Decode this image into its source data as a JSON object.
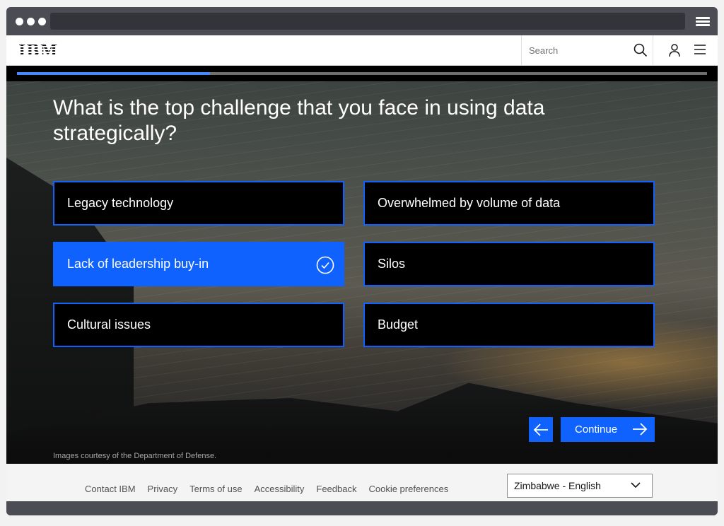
{
  "masthead": {
    "logo": "IBM",
    "search_placeholder": "Search"
  },
  "quiz": {
    "progress": 0.28,
    "question": "What is the top challenge that you face in using data strategically?",
    "options": [
      {
        "label": "Legacy technology",
        "selected": false
      },
      {
        "label": "Overwhelmed by volume of data",
        "selected": false
      },
      {
        "label": "Lack of leadership buy-in",
        "selected": true
      },
      {
        "label": "Silos",
        "selected": false
      },
      {
        "label": "Cultural issues",
        "selected": false
      },
      {
        "label": "Budget",
        "selected": false
      }
    ],
    "continue_label": "Continue",
    "credit": "Images courtesy of the Department of Defense."
  },
  "footer": {
    "links": [
      "Contact IBM",
      "Privacy",
      "Terms of use",
      "Accessibility",
      "Feedback",
      "Cookie preferences"
    ],
    "locale": "Zimbabwe - English"
  },
  "colors": {
    "accent": "#0f62fe",
    "progress": "#4589ff",
    "option_bg": "#000000"
  }
}
